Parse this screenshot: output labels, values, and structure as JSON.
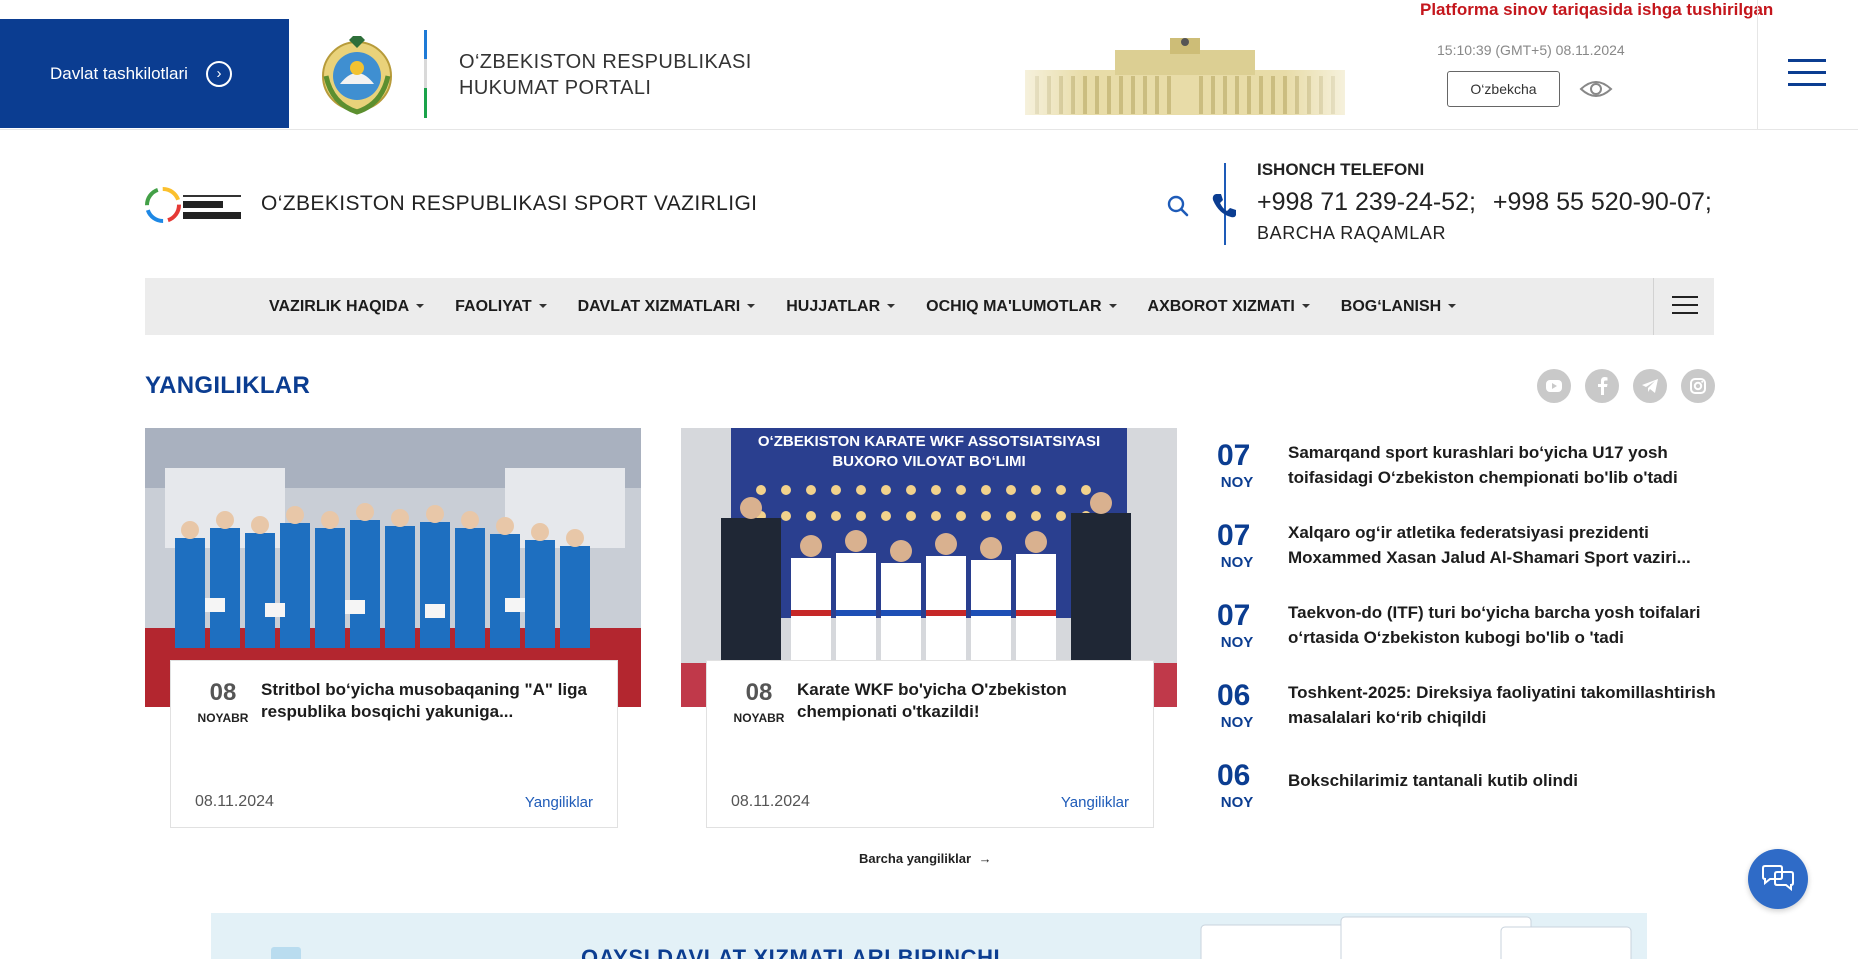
{
  "gov_bar": {
    "orgs_label": "Davlat tashkilotlari",
    "portal_title_line1": "O‘ZBEKISTON RESPUBLIKASI",
    "portal_title_line2": "HUKUMAT PORTALI",
    "notice": "Platforma sinov tariqasida ishga tushirilgan",
    "clock": "15:10:39 (GMT+5) 08.11.2024",
    "language": "O‘zbekcha"
  },
  "ministry": {
    "title": "O‘ZBEKISTON RESPUBLIKASI SPORT VAZIRLIGI",
    "hotline_label": "ISHONCH TELEFONI",
    "phones": [
      "+998 71 239-24-52;",
      "+998 55 520-90-07;"
    ],
    "all_numbers": "BARCHA RAQAMLAR"
  },
  "nav": {
    "items": [
      {
        "label": "VAZIRLIK HAQIDA"
      },
      {
        "label": "FAOLIYAT"
      },
      {
        "label": "DAVLAT XIZMATLARI"
      },
      {
        "label": "HUJJATLAR"
      },
      {
        "label": "OCHIQ MA'LUMOTLAR"
      },
      {
        "label": "AXBOROT XIZMATI"
      },
      {
        "label": "BOG‘LANISH"
      }
    ]
  },
  "news": {
    "heading": "YANGILIKLAR",
    "socials": [
      "youtube-icon",
      "facebook-icon",
      "telegram-icon",
      "instagram-icon"
    ],
    "cards": [
      {
        "day": "08",
        "month": "NOYABR",
        "title": "Stritbol bo‘yicha musobaqaning \"A\" liga respublika bosqichi yakuniga...",
        "date": "08.11.2024",
        "category": "Yangiliklar"
      },
      {
        "day": "08",
        "month": "NOYABR",
        "title": "Karate WKF bo'yicha O'zbekiston chempionati o'tkazildi!",
        "date": "08.11.2024",
        "category": "Yangiliklar",
        "banner_line1": "O‘ZBEKISTON KARATE WKF ASSOTSIATSIYASI",
        "banner_line2": "BUXORO VILOYAT BO‘LIMI"
      }
    ],
    "side": [
      {
        "day": "07",
        "month": "NOY",
        "title": "Samarqand sport kurashlari bo‘yicha U17 yosh toifasidagi O‘zbekiston chempionati bo'lib o'tadi"
      },
      {
        "day": "07",
        "month": "NOY",
        "title": "Xalqaro og‘ir atletika federatsiyasi prezidenti Moxammed Xasan Jalud Al-Shamari Sport vaziri..."
      },
      {
        "day": "07",
        "month": "NOY",
        "title": "Taekvon-do (ITF) turi bo‘yicha barcha yosh toifalari o‘rtasida O‘zbekiston kubogi bo'lib o 'tadi"
      },
      {
        "day": "06",
        "month": "NOY",
        "title": "Toshkent-2025: Direksiya faoliyatini takomillashtirish masalalari ko‘rib chiqildi"
      },
      {
        "day": "06",
        "month": "NOY",
        "title": "Bokschilarimiz tantanali kutib olindi"
      }
    ],
    "all_label": "Barcha yangiliklar"
  },
  "promo": {
    "text": "QAYSI DAVLAT XIZMATLARI BIRINCHI"
  },
  "colors": {
    "brand_blue": "#0b3d91",
    "notice_red": "#c4161c",
    "link_blue": "#1e5bb8"
  }
}
